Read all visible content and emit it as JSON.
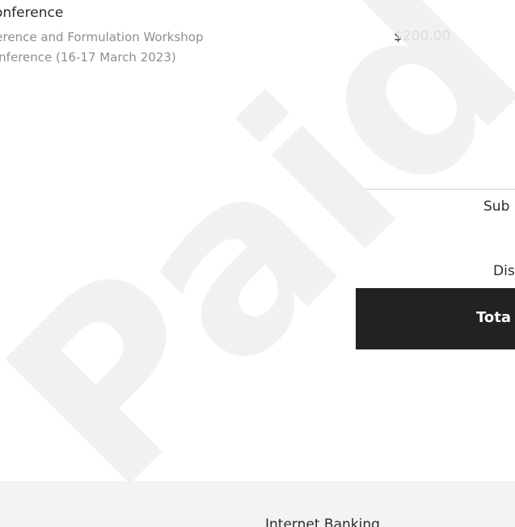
{
  "line_item": {
    "title": "onference",
    "description_lines": [
      "ference and Formulation Workshop",
      "onference (16-17 March 2023)"
    ],
    "price": "$200.00"
  },
  "totals": {
    "subtotal_label": "Sub",
    "discount_label": "Dis",
    "total_label": "Tota"
  },
  "payment": {
    "method": "Internet Banking"
  },
  "watermark": {
    "text": "Paid",
    "color": "#efefef"
  },
  "colors": {
    "total_bar": "#222222",
    "payment_band": "#f3f3f3"
  }
}
